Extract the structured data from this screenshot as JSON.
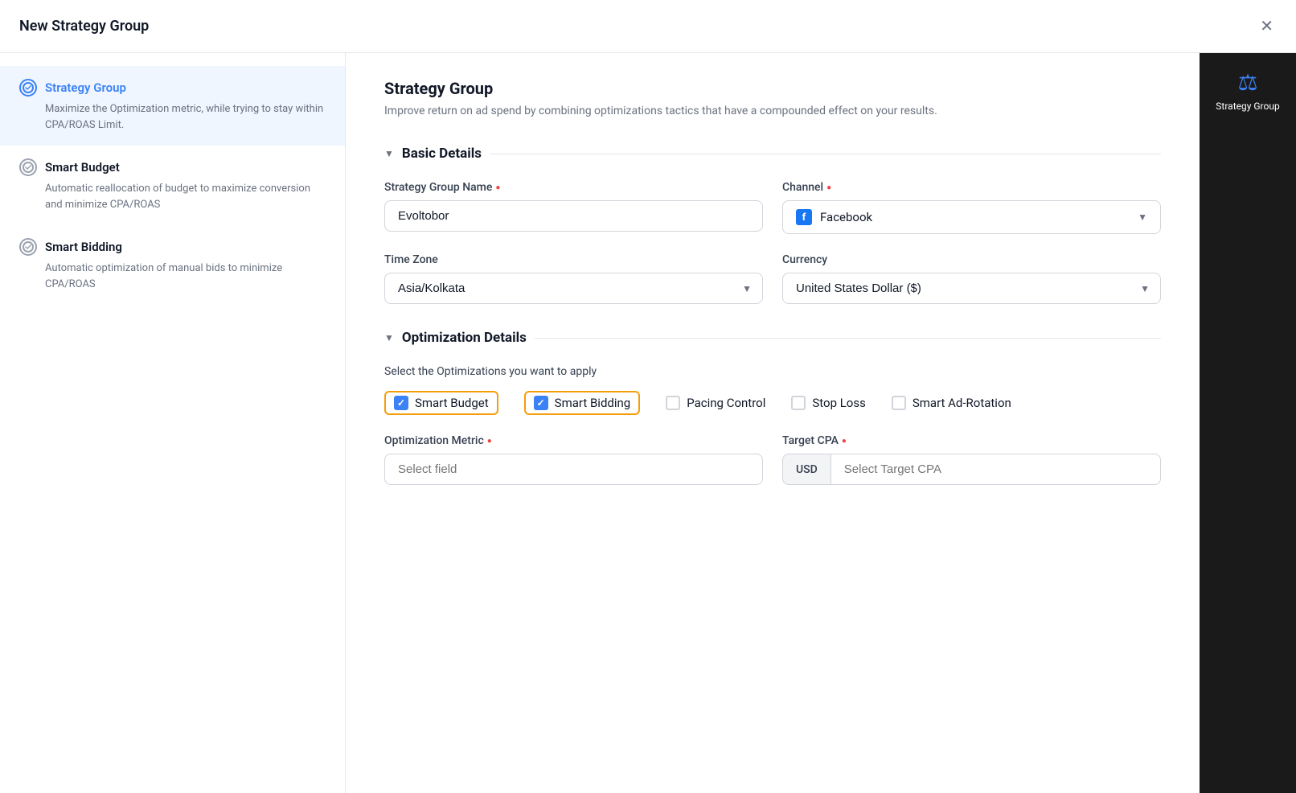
{
  "modal": {
    "title": "New Strategy Group",
    "close_label": "×"
  },
  "sidebar": {
    "items": [
      {
        "id": "strategy-group",
        "title": "Strategy Group",
        "description": "Maximize the Optimization metric, while trying to stay within CPA/ROAS Limit.",
        "active": true,
        "icon": "circle-check"
      },
      {
        "id": "smart-budget",
        "title": "Smart Budget",
        "description": "Automatic reallocation of budget to maximize conversion and minimize CPA/ROAS",
        "active": false,
        "icon": "circle-check"
      },
      {
        "id": "smart-bidding",
        "title": "Smart Bidding",
        "description": "Automatic optimization of manual bids to minimize CPA/ROAS",
        "active": false,
        "icon": "circle-check"
      }
    ]
  },
  "main": {
    "section_title": "Strategy Group",
    "section_desc": "Improve return on ad spend by combining optimizations tactics that have a compounded effect on your results.",
    "basic_details": {
      "label": "Basic Details",
      "strategy_group_name_label": "Strategy Group Name",
      "strategy_group_name_value": "Evoltobor",
      "channel_label": "Channel",
      "channel_value": "Facebook",
      "timezone_label": "Time Zone",
      "timezone_value": "Asia/Kolkata",
      "currency_label": "Currency",
      "currency_value": "United States Dollar ($)"
    },
    "optimization_details": {
      "label": "Optimization Details",
      "select_optimizations_label": "Select the Optimizations you want to apply",
      "checkboxes": [
        {
          "id": "smart-budget",
          "label": "Smart Budget",
          "checked": true,
          "highlighted": true
        },
        {
          "id": "smart-bidding",
          "label": "Smart Bidding",
          "checked": true,
          "highlighted": true
        },
        {
          "id": "pacing-control",
          "label": "Pacing Control",
          "checked": false,
          "highlighted": false
        },
        {
          "id": "stop-loss",
          "label": "Stop Loss",
          "checked": false,
          "highlighted": false
        },
        {
          "id": "smart-ad-rotation",
          "label": "Smart Ad-Rotation",
          "checked": false,
          "highlighted": false
        }
      ],
      "optimization_metric_label": "Optimization Metric",
      "optimization_metric_placeholder": "Select field",
      "target_cpa_label": "Target CPA",
      "target_cpa_currency_prefix": "USD",
      "target_cpa_placeholder": "Select Target CPA"
    }
  },
  "right_panel": {
    "label": "Strategy Group"
  },
  "icons": {
    "close": "✕",
    "chevron_down": "▼",
    "chevron_right": "▶",
    "check": "✓",
    "balance": "⚖"
  }
}
